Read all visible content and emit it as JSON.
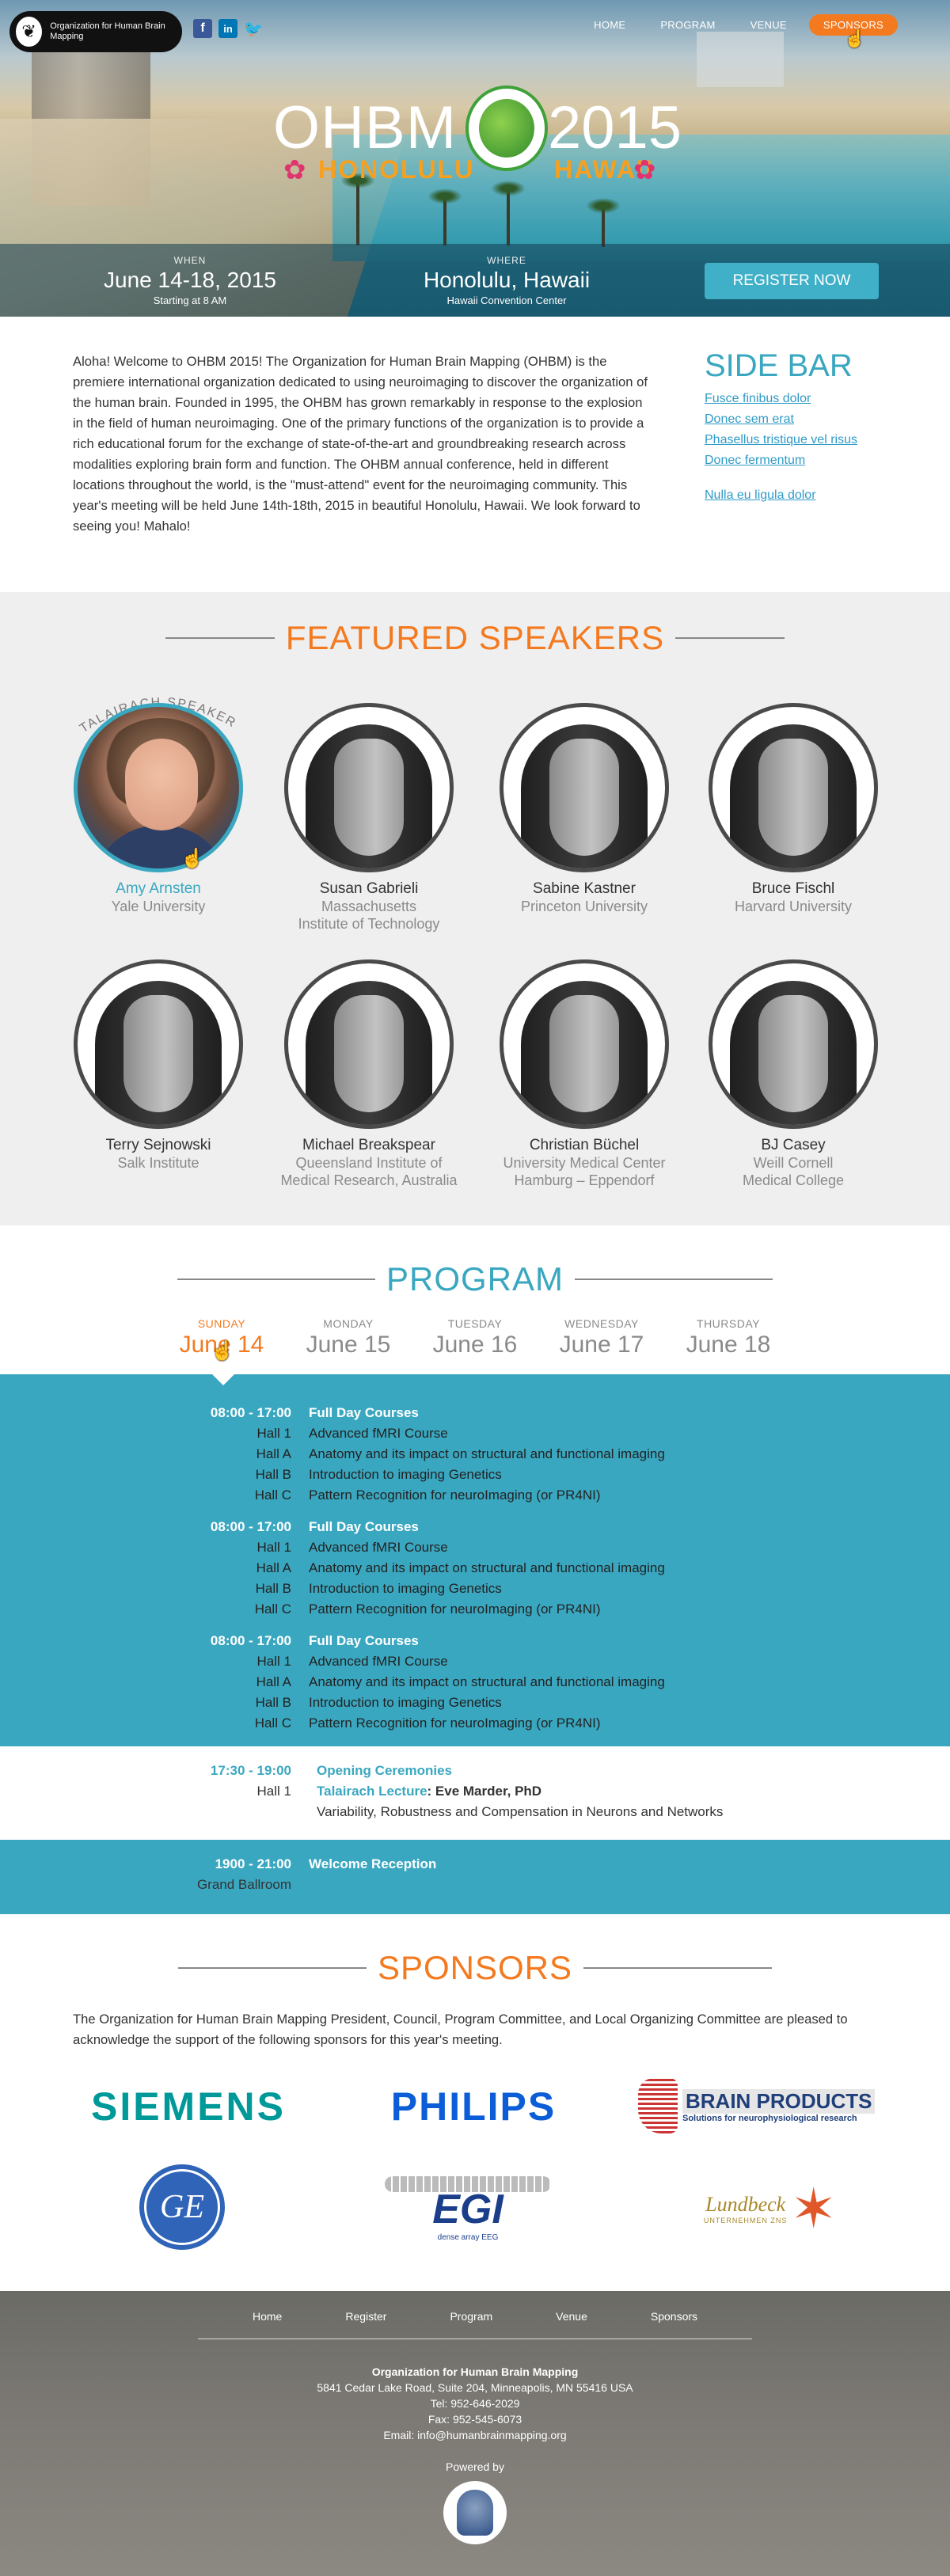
{
  "header": {
    "logo_text": "Organization for Human Brain Mapping",
    "social": [
      {
        "icon": "facebook-icon",
        "glyph": "f",
        "color": "#3b5998"
      },
      {
        "icon": "linkedin-icon",
        "glyph": "in",
        "color": "#0077b5"
      },
      {
        "icon": "twitter-icon",
        "glyph": "🐦",
        "color": "#1da1f2"
      }
    ],
    "nav": [
      "HOME",
      "PROGRAM",
      "VENUE",
      "SPONSORS"
    ],
    "active_nav": "SPONSORS"
  },
  "hero": {
    "title_left": "OHBM",
    "title_right": "2015",
    "city": "HONOLULU",
    "state": "HAWAII",
    "when_label": "WHEN",
    "when_value": "June 14-18, 2015",
    "when_sub": "Starting at 8 AM",
    "where_label": "WHERE",
    "where_value": "Honolulu, Hawaii",
    "where_sub": "Hawaii Convention Center",
    "register_label": "REGISTER NOW"
  },
  "intro": {
    "text": "Aloha!  Welcome to OHBM 2015!  The Organization for Human Brain Mapping (OHBM) is the premiere international organization dedicated to using neuroimaging to discover the organization of the human brain. Founded in 1995, the OHBM has grown remarkably in response to the explosion in the field of human neuroimaging. One of the primary functions of the organization is to provide a rich educational forum for the exchange of state-of-the-art and groundbreaking research across modalities exploring brain form and function.  The OHBM annual conference, held in different locations throughout the world, is the \"must-attend\" event for the neuroimaging community.  This year's meeting will be held June 14th-18th, 2015 in beautiful Honolulu, Hawaii.  We look forward to seeing you!  Mahalo!"
  },
  "sidebar": {
    "title": "SIDE BAR",
    "links": [
      "Fusce finibus dolor",
      "Donec sem erat",
      "Phasellus tristique vel risus",
      "Donec fermentum",
      "Nulla eu ligula dolor"
    ]
  },
  "speakers": {
    "title": "FEATURED SPEAKERS",
    "badge": "TALAIRACH SPEAKER",
    "items": [
      {
        "name": "Amy Arnsten",
        "aff1": "Yale University",
        "aff2": ""
      },
      {
        "name": "Susan Gabrieli",
        "aff1": "Massachusetts",
        "aff2": "Institute of Technology"
      },
      {
        "name": "Sabine Kastner",
        "aff1": "Princeton University",
        "aff2": ""
      },
      {
        "name": "Bruce Fischl",
        "aff1": "Harvard University",
        "aff2": ""
      },
      {
        "name": "Terry Sejnowski",
        "aff1": "Salk Institute",
        "aff2": ""
      },
      {
        "name": "Michael Breakspear",
        "aff1": "Queensland Institute of",
        "aff2": "Medical Research, Australia"
      },
      {
        "name": "Christian Büchel",
        "aff1": "University Medical Center",
        "aff2": "Hamburg – Eppendorf"
      },
      {
        "name": "BJ Casey",
        "aff1": "Weill Cornell",
        "aff2": "Medical College"
      }
    ]
  },
  "program": {
    "title": "PROGRAM",
    "days": [
      {
        "dn": "SUNDAY",
        "dd": "June 14"
      },
      {
        "dn": "MONDAY",
        "dd": "June 15"
      },
      {
        "dn": "TUESDAY",
        "dd": "June 16"
      },
      {
        "dn": "WEDNESDAY",
        "dd": "June 17"
      },
      {
        "dn": "THURSDAY",
        "dd": "June 18"
      }
    ],
    "blocks": [
      {
        "time": "08:00 - 17:00",
        "head": "Full Day Courses",
        "rows": [
          [
            "Hall 1",
            "Advanced fMRI Course"
          ],
          [
            "Hall A",
            "Anatomy and its impact on structural and functional imaging"
          ],
          [
            "Hall B",
            "Introduction to imaging Genetics"
          ],
          [
            "Hall C",
            "Pattern Recognition for neuroImaging (or PR4NI)"
          ]
        ]
      },
      {
        "time": "08:00 - 17:00",
        "head": "Full Day Courses",
        "rows": [
          [
            "Hall 1",
            "Advanced fMRI Course"
          ],
          [
            "Hall A",
            "Anatomy and its impact on structural and functional imaging"
          ],
          [
            "Hall B",
            "Introduction to imaging Genetics"
          ],
          [
            "Hall C",
            "Pattern Recognition for neuroImaging (or PR4NI)"
          ]
        ]
      },
      {
        "time": "08:00 - 17:00",
        "head": "Full Day Courses",
        "rows": [
          [
            "Hall 1",
            "Advanced fMRI Course"
          ],
          [
            "Hall A",
            "Anatomy and its impact on structural and functional imaging"
          ],
          [
            "Hall B",
            "Introduction to imaging Genetics"
          ],
          [
            "Hall C",
            "Pattern Recognition for neuroImaging (or PR4NI)"
          ]
        ]
      }
    ],
    "opening": {
      "time": "17:30 - 19:00",
      "head": "Opening Ceremonies",
      "hall": "Hall 1",
      "lecture_label": "Talairach Lecture",
      "lecture_speaker": ": Eve Marder, PhD",
      "lecture_title": "Variability, Robustness and Compensation in Neurons and Networks"
    },
    "reception": {
      "time": "1900 - 21:00",
      "head": "Welcome Reception",
      "place": "Grand Ballroom"
    }
  },
  "sponsors": {
    "title": "SPONSORS",
    "text": "The Organization for Human Brain Mapping President, Council, Program Committee, and Local Organizing Committee are pleased to acknowledge the support of the following sponsors for this year's meeting.",
    "logos": [
      "SIEMENS",
      "PHILIPS",
      "BRAIN PRODUCTS",
      "Solutions for neurophysiological research",
      "GE",
      "EGI",
      "dense array EEG",
      "Lundbeck",
      "UNTERNEHMEN ZNS"
    ]
  },
  "footer": {
    "nav": [
      "Home",
      "Register",
      "Program",
      "Venue",
      "Sponsors"
    ],
    "org": "Organization for Human Brain Mapping",
    "address": "5841 Cedar Lake Road, Suite 204, Minneapolis, MN 55416 USA",
    "tel": "Tel: 952-646-2029",
    "fax": "Fax: 952-545-6073",
    "email": "Email: info@humanbrainmapping.org",
    "powered": "Powered by"
  },
  "colors": {
    "accent_orange": "#f47a20",
    "accent_teal": "#3aa7c0"
  }
}
